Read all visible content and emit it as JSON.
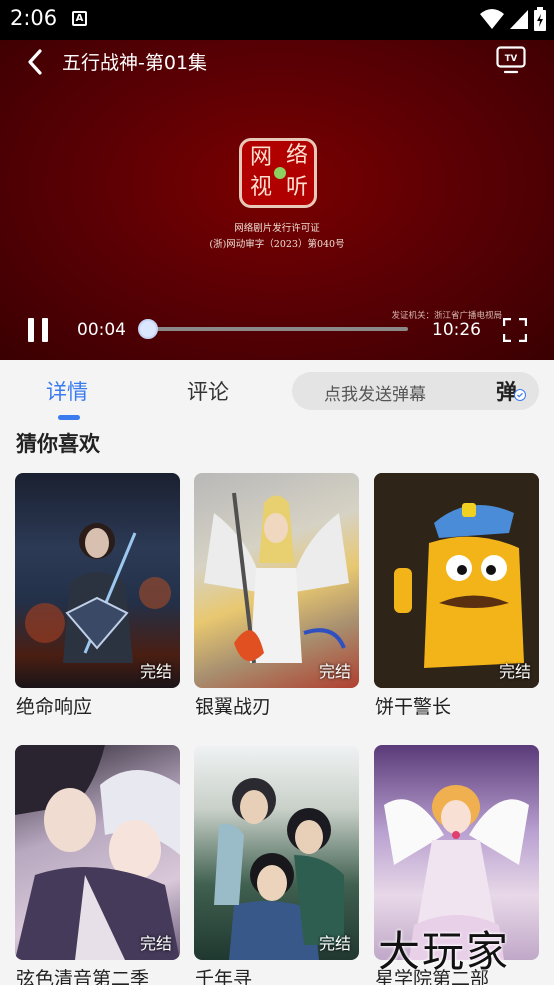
{
  "status_bar": {
    "time": "2:06",
    "notification_icon": "a-icon"
  },
  "player": {
    "title": "五行战神-第01集",
    "license_line1": "网络剧片发行许可证",
    "license_line2": "(浙)网动审字（2023）第040号",
    "issuer": "发证机关：浙江省广播电视局",
    "current_time": "00:04",
    "duration": "10:26",
    "progress_fraction": 0.006,
    "seal_chars": [
      "网",
      "络",
      "视",
      "听"
    ]
  },
  "tabs": [
    {
      "label": "详情",
      "active": true
    },
    {
      "label": "评论",
      "active": false
    }
  ],
  "danmu": {
    "placeholder": "点我发送弹幕",
    "button_label": "弹"
  },
  "recommend": {
    "title": "猜你喜欢",
    "items": [
      {
        "name": "绝命响应",
        "badge": "完结"
      },
      {
        "name": "银翼战刃",
        "badge": "完结"
      },
      {
        "name": "饼干警长",
        "badge": "完结"
      },
      {
        "name": "弦色清音第二季",
        "badge": "完结"
      },
      {
        "name": "千年寻",
        "badge": "完结"
      },
      {
        "name": "星学院第二部",
        "badge": ""
      }
    ]
  },
  "watermark": "大玩家",
  "colors": {
    "accent": "#3b7bf0",
    "player_bg": "#5c0004"
  }
}
